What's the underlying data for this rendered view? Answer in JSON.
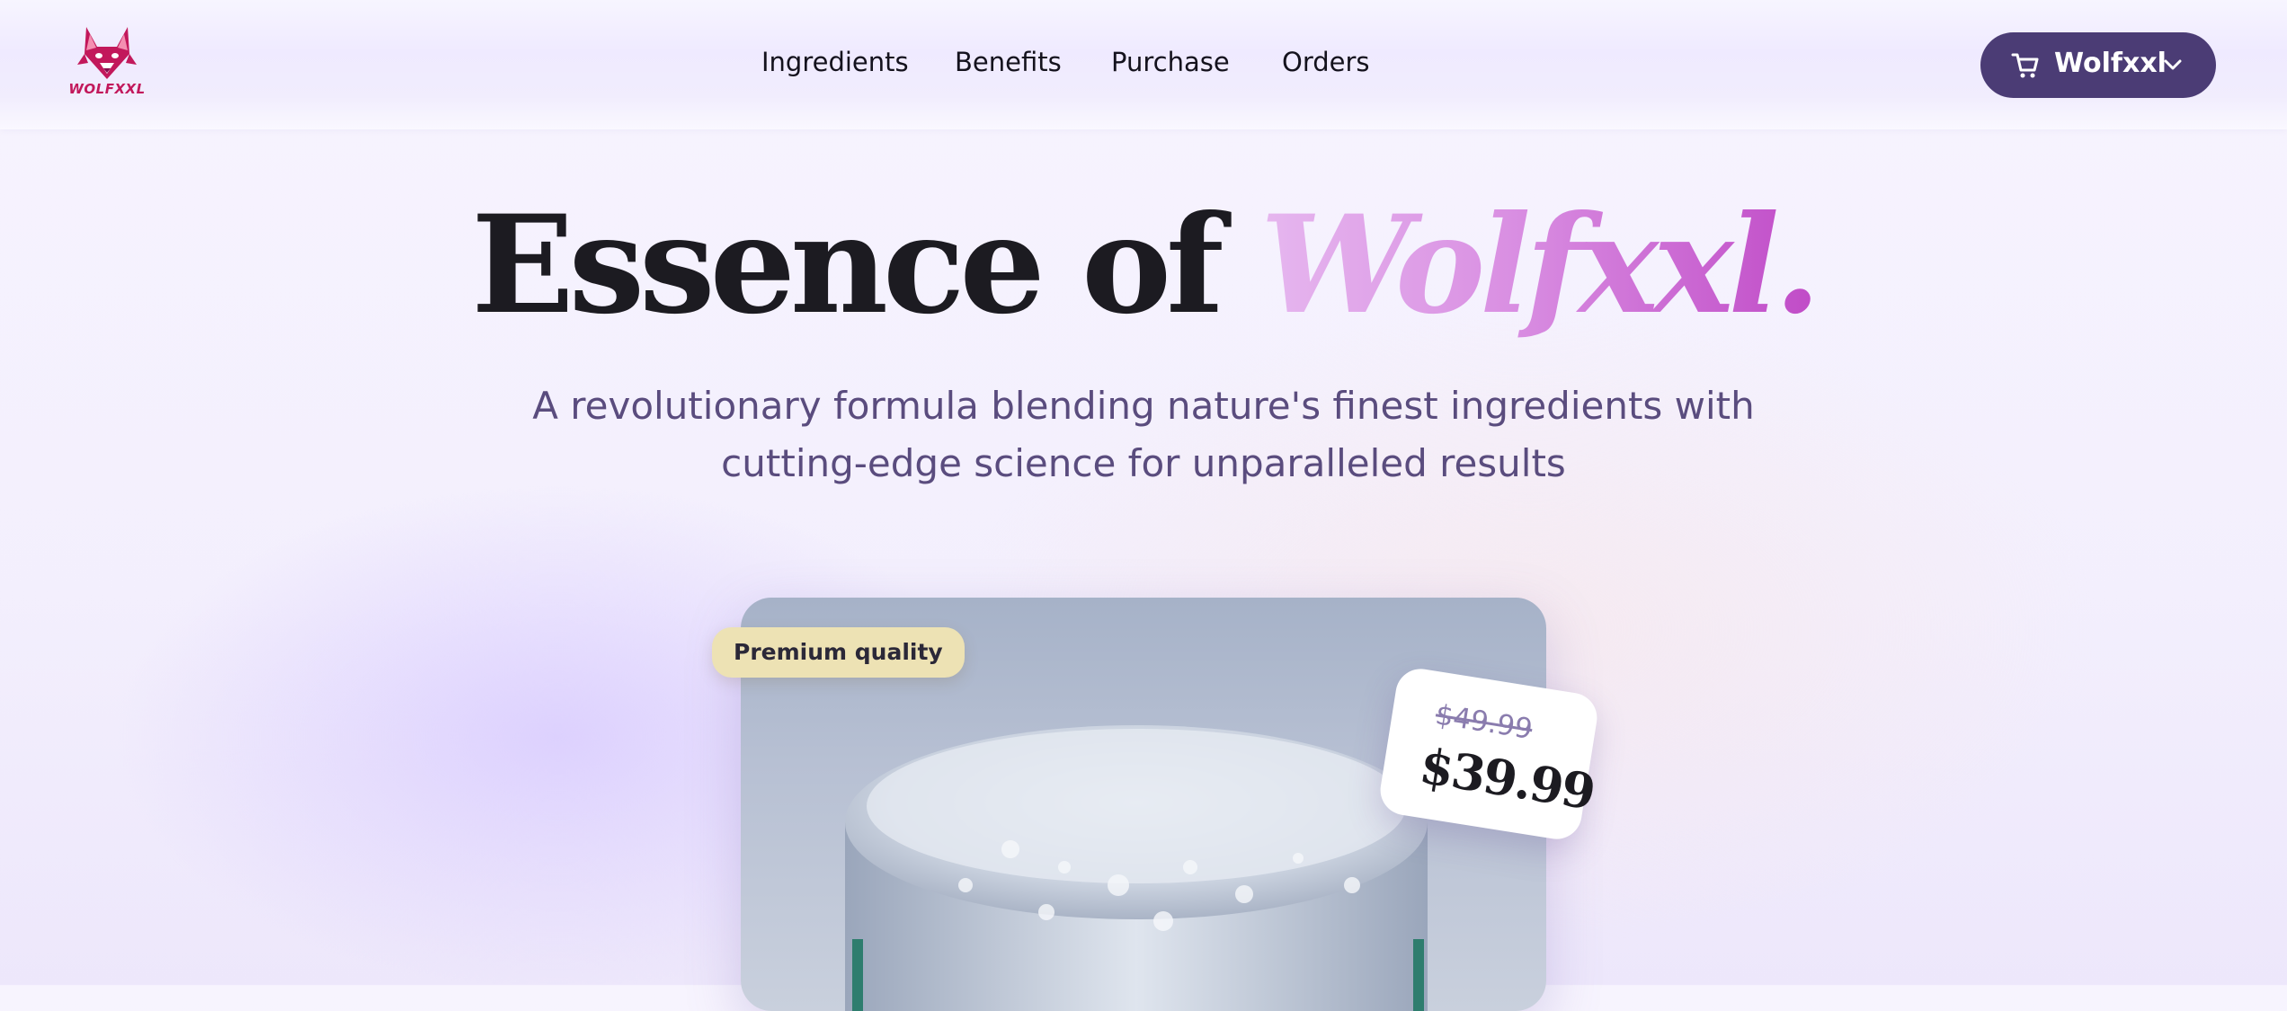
{
  "brand": {
    "logo_text": "WOLFXXL",
    "logo_color": "#c2185b"
  },
  "nav": {
    "items": [
      {
        "label": "Ingredients"
      },
      {
        "label": "Benefits"
      },
      {
        "label": "Purchase"
      },
      {
        "label": "Orders"
      }
    ]
  },
  "cart": {
    "label": "Wolfxxl",
    "icon": "cart-icon",
    "dropdown_icon": "chevron-down-icon",
    "bg_color": "#4b3c75"
  },
  "hero": {
    "title_plain": "Essence of ",
    "title_accent": "Wolfxxl.",
    "subtitle": "A revolutionary formula blending nature's finest ingredients with cutting-edge science for unparalleled results",
    "accent_gradient": [
      "#e6b7ef",
      "#c04bc7"
    ]
  },
  "product": {
    "badge": "Premium quality",
    "old_price": "$49.99",
    "price": "$39.99"
  }
}
